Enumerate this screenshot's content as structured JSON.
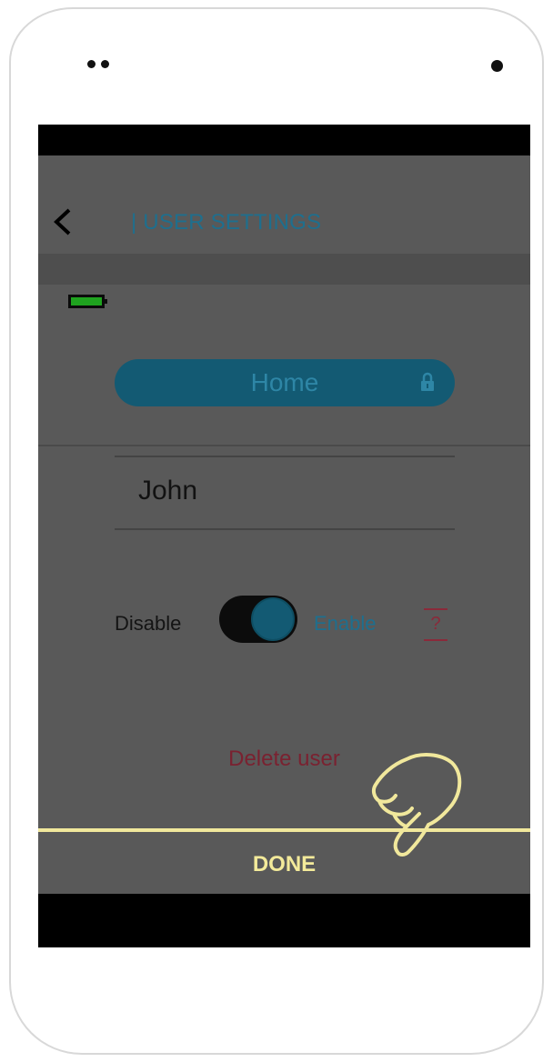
{
  "header": {
    "title": "| USER SETTINGS"
  },
  "profile": {
    "name": "Home"
  },
  "user": {
    "name": "John"
  },
  "status": {
    "disable_label": "Disable",
    "enable_label": "Enable",
    "enabled": true,
    "help": "?"
  },
  "actions": {
    "delete_label": "Delete user",
    "done_label": "DONE"
  },
  "battery": {
    "level": 1.0,
    "color": "#1fa31f"
  },
  "colors": {
    "accent": "#135a73",
    "overlay": "#595959",
    "danger": "#7a2130",
    "highlight": "#f1e89c"
  },
  "icons": [
    "back-arrow-icon",
    "lock-icon",
    "battery-icon",
    "pointing-hand-icon"
  ]
}
